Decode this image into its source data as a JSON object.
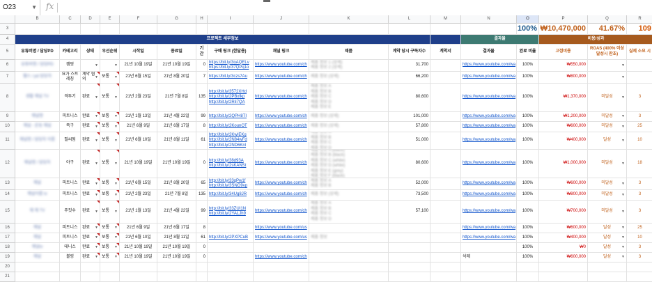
{
  "formula_bar": {
    "cell_ref": "O23",
    "fx_icon": "fx-icon"
  },
  "col_headers": [
    "",
    "B",
    "C",
    "D",
    "E",
    "F",
    "G",
    "H",
    "I",
    "J",
    "K",
    "L",
    "M",
    "N",
    "O",
    "P",
    "Q",
    "R"
  ],
  "row_numbers": [
    "3",
    "4",
    "5",
    "6",
    "7",
    "8",
    "9",
    "10",
    "11",
    "12",
    "13",
    "14",
    "15",
    "16",
    "17",
    "18",
    "19",
    "20",
    "21"
  ],
  "summary": {
    "pct1": "100%",
    "total": "₩10,470,000",
    "pct2": "41.67%",
    "count": "109"
  },
  "group_headers": {
    "project": "프로젝트 세부정보",
    "result": "결과물",
    "cost": "비용/성과"
  },
  "headers": {
    "youtuber": "유튜버명 / 담당PD",
    "category": "카테고리",
    "status": "상태",
    "priority": "우선순위",
    "start": "시작일",
    "end": "종료일",
    "period": "기간",
    "purchase_link": "구매 링크 (한달용)",
    "channel_link": "채널 링크",
    "product": "제품",
    "subscribers": "계약 당시 구독자수",
    "contract": "계약서",
    "result": "결과물",
    "completion": "완료 비율",
    "fixed_cost": "고정비용",
    "roas": "ROAS (400% 이상 달성시 판초)",
    "actual_sales": "실제 소요 시"
  },
  "rows": [
    {
      "row": "6",
      "name": "유튜버명 / 담당PD",
      "category": "캠핑",
      "status": "",
      "priority": "",
      "start": "21년 10월 19일",
      "end": "21년 10월 19일",
      "period": "0",
      "links": [
        "https://bit.ly/3oAQELv",
        "https://bit.ly/37QPq1o"
      ],
      "channel": "https://www.youtube.com/ch",
      "product": [
        "제품 정보 1 (상세)",
        "제품 정보 2 (상세)"
      ],
      "subs": "31,700",
      "result": "https://www.youtube.com/wa",
      "completion": "100%",
      "fixed": "₩550,000",
      "roas": "",
      "actual": ""
    },
    {
      "row": "7",
      "name": "헬스 / pd 담당자",
      "category": "요가 스트레칭",
      "status": "계약 협의",
      "priority": "보통",
      "start": "21년 6월 15일",
      "end": "21년 8월 20일",
      "period": "7",
      "links": [
        "https://bit.ly/3czs7Au"
      ],
      "channel": "https://www.youtube.com/ch",
      "product": [
        "제품 정보 (상세)"
      ],
      "subs": "66,200",
      "result": "https://www.youtube.com/wa",
      "completion": "100%",
      "fixed": "₩800,000",
      "roas": "",
      "actual": ""
    },
    {
      "row": "8",
      "name": "생활 채널 TV",
      "category": "격투기",
      "status": "완료",
      "priority": "보통",
      "start": "21년 2월 23일",
      "end": "21년 7월 8일",
      "period": "135",
      "links": [
        "http://bit.ly/3572XHd",
        "http://bit.ly/2PBxfkp",
        "http://bit.ly/2RiI7QA"
      ],
      "channel": "https://www.youtube.com/ch",
      "product": [
        "제품 정보 A",
        "제품 정보 B",
        "제품 정보 C",
        "제품 정보 D",
        "제품 정보 E"
      ],
      "subs": "80,600",
      "result": "https://www.youtube.com/wa",
      "completion": "100%",
      "fixed": "₩1,370,000",
      "roas": "미달성",
      "actual": "3"
    },
    {
      "row": "9",
      "name": "채널명",
      "category": "피트니스",
      "status": "완료",
      "priority": "보통",
      "start": "21년 1월 13일",
      "end": "21년 4월 22일",
      "period": "99",
      "links": [
        "http://bit.ly/2QPH8TI"
      ],
      "channel": "https://www.youtube.com/ch",
      "product": [
        "제품 정보 (상세)"
      ],
      "subs": "101,000",
      "result": "https://www.youtube.com/wa",
      "completion": "100%",
      "fixed": "₩1,200,000",
      "roas": "미달성",
      "actual": "3"
    },
    {
      "row": "10",
      "name": "채널 - 운동 채널",
      "category": "족구",
      "status": "완료",
      "priority": "보통",
      "start": "21년 6월 9일",
      "end": "21년 6월 17일",
      "period": "8",
      "links": [
        "http://bit.ly/2KounOT"
      ],
      "channel": "https://www.youtube.com/ch",
      "product": [
        "제품 정보 (상세)"
      ],
      "subs": "57,800",
      "result": "https://www.youtube.com/wa",
      "completion": "100%",
      "fixed": "₩600,000",
      "roas": "미달성",
      "actual": "25"
    },
    {
      "row": "11",
      "name": "채널명 / 담당자 이름",
      "category": "필씨됨",
      "status": "완료",
      "priority": "보통",
      "start": "21년 6월 10일",
      "end": "21년 8월 11일",
      "period": "61",
      "links": [
        "http://bit.ly/2KwIEKg",
        "http://bit.ly/2N84wFd",
        "http://bit.ly/2ND6Knl"
      ],
      "channel": "https://www.youtube.com/ch",
      "product": [
        "제품 정보 A",
        "제품 정보 B",
        "제품 정보 C",
        "제품 정보 D"
      ],
      "subs": "51,000",
      "result": "https://www.youtube.com/wa",
      "completion": "100%",
      "fixed": "₩400,000",
      "roas": "달성",
      "actual": "10"
    },
    {
      "row": "12",
      "name": "채널명 / 담당자",
      "category": "야구",
      "status": "완료",
      "priority": "보통",
      "start": "21년 10월 19일",
      "end": "21년 10월 19일",
      "period": "0",
      "links": [
        "http://bit.ly/38d93A",
        "http://bit.ly/2sKANSt"
      ],
      "channel": "https://www.youtube.com/ch",
      "product": [
        "제품 정보 A (black)",
        "제품 정보 B (black)",
        "제품 정보 C (white)",
        "제품 정보 D (white)",
        "제품 정보 E (grey)",
        "제품 정보 F (black)"
      ],
      "subs": "80,600",
      "result": "https://www.youtube.com/wa",
      "completion": "100%",
      "fixed": "₩1,000,000",
      "roas": "미달성",
      "actual": "18"
    },
    {
      "row": "13",
      "name": "채널",
      "category": "피트니스",
      "status": "완료",
      "priority": "보통",
      "start": "21년 6월 15일",
      "end": "21년 8월 20일",
      "period": "65",
      "links": [
        "http://bit.ly/33qPw1f",
        "http://bit.ly/3SNO9vp"
      ],
      "channel": "https://www.youtube.com/ch",
      "product": [
        "제품 정보 A",
        "제품 정보 B"
      ],
      "subs": "52,000",
      "result": "https://www.youtube.com/wa",
      "completion": "100%",
      "fixed": "₩600,000",
      "roas": "미달성",
      "actual": "3"
    },
    {
      "row": "14",
      "name": "채널이름 tv",
      "category": "피트니스",
      "status": "완료",
      "priority": "보통",
      "start": "21년 2월 23일",
      "end": "21년 7월 8일",
      "period": "135",
      "links": [
        "http://bit.ly/34Ug8JR"
      ],
      "channel": "https://www.youtube.com/ch",
      "product": [
        "제품 정보 (상세)"
      ],
      "subs": "73,500",
      "result": "https://www.youtube.com/wa",
      "completion": "100%",
      "fixed": "₩800,000",
      "roas": "미달성",
      "actual": "3"
    },
    {
      "row": "15",
      "name": "채 채 TV",
      "category": "주짓수",
      "status": "완료",
      "priority": "보통",
      "start": "21년 1월 13일",
      "end": "21년 4월 22일",
      "period": "99",
      "links": [
        "http://bit.ly/33ZUI1N",
        "http://bit.ly/2YALJh9"
      ],
      "channel": "https://www.youtube.com/ch",
      "product": [
        "제품 정보 A",
        "제품 정보 B",
        "제품 정보 C",
        "제품 정보 D"
      ],
      "subs": "57,100",
      "result": "https://www.youtube.com/wa",
      "completion": "100%",
      "fixed": "₩700,000",
      "roas": "미달성",
      "actual": "3"
    },
    {
      "row": "16",
      "name": "채널",
      "category": "피트니스",
      "status": "완료",
      "priority": "보통",
      "start": "21년 6월 9일",
      "end": "21년 6월 17일",
      "period": "8",
      "links": [],
      "channel": "https://www.youtube.com/us",
      "product": [],
      "subs": "",
      "result": "https://www.youtube.com/wa",
      "completion": "100%",
      "fixed": "₩600,000",
      "roas": "달성",
      "actual": "25"
    },
    {
      "row": "17",
      "name": "채널",
      "category": "피트니스",
      "status": "완료",
      "priority": "보통",
      "start": "21년 6월 10일",
      "end": "21년 8월 11일",
      "period": "61",
      "links": [
        "http://bit.ly/2PXPCuB"
      ],
      "channel": "https://www.youtube.com/us",
      "product": [
        "제품 정보"
      ],
      "subs": "",
      "result": "https://www.youtube.com/wa",
      "completion": "100%",
      "fixed": "₩400,000",
      "roas": "달성",
      "actual": "10"
    },
    {
      "row": "18",
      "name": "채널tv",
      "category": "테니스",
      "status": "완료",
      "priority": "보통",
      "start": "21년 10월 19일",
      "end": "21년 10월 19일",
      "period": "0",
      "links": [],
      "channel": "",
      "product": [],
      "subs": "",
      "result": "",
      "completion": "100%",
      "fixed": "₩0",
      "roas": "달성",
      "actual": "3"
    },
    {
      "row": "19",
      "name": "채널",
      "category": "볼링",
      "status": "완료",
      "priority": "보통",
      "start": "21년 10월 19일",
      "end": "21년 10월 19일",
      "period": "0",
      "links": [],
      "channel": "https://www.youtube.com/ch",
      "product": [],
      "subs": "",
      "result": "삭제",
      "completion": "100%",
      "fixed": "₩600,000",
      "roas": "달성",
      "actual": "3"
    }
  ]
}
